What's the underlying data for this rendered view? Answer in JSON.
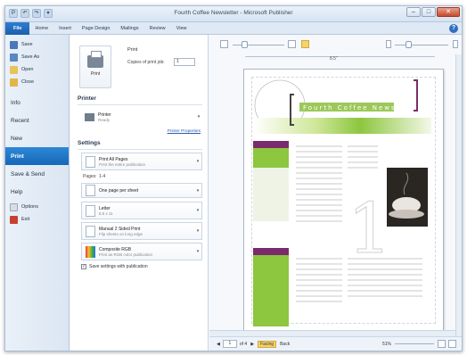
{
  "window": {
    "title": "Fourth Coffee Newsletter - Microsoft Publisher",
    "qat": [
      "P",
      "↶",
      "↷",
      "▾"
    ],
    "controls": {
      "minimize": "–",
      "maximize": "□",
      "close": "✕"
    }
  },
  "ribbon": {
    "tabs": [
      "File",
      "Home",
      "Insert",
      "Page Design",
      "Mailings",
      "Review",
      "View"
    ],
    "help": "?"
  },
  "nav": {
    "small_items": [
      "Save",
      "Save As",
      "Open",
      "Close"
    ],
    "big_items": [
      "Info",
      "Recent",
      "New",
      "Print",
      "Save & Send",
      "Help"
    ],
    "bottom_items": [
      "Options",
      "Exit"
    ],
    "active": "Print"
  },
  "print": {
    "button_label": "Print",
    "heading": "Print",
    "copies_label": "Copies of print job:",
    "copies_value": "1"
  },
  "printer": {
    "heading": "Printer",
    "name": "Printer",
    "status": "Ready",
    "properties_link": "Printer Properties"
  },
  "settings": {
    "heading": "Settings",
    "pages_title": "Print All Pages",
    "pages_sub": "Print the entire publication",
    "pages_label": "Pages:",
    "pages_value": "1-4",
    "layout_title": "One page per sheet",
    "paper_title": "Letter",
    "paper_sub": "8.5 x 11",
    "duplex_title": "Manual 2 Sided Print",
    "duplex_sub": "Flip sheets on long edge",
    "color_title": "Composite RGB",
    "color_sub": "Print as RGB color publication",
    "save_with_pub": "Save settings with publication",
    "save_checked": "✓"
  },
  "preview": {
    "ruler_label": "8.5\"",
    "page_label": "of 4",
    "page_value": "1",
    "facing": "Facing",
    "back": "Back",
    "zoom": "51%",
    "prev": "◀",
    "next": "▶"
  },
  "colors": {
    "accent": "#1f6fc4",
    "green": "#8dc63f",
    "purple": "#7a2b6d"
  }
}
